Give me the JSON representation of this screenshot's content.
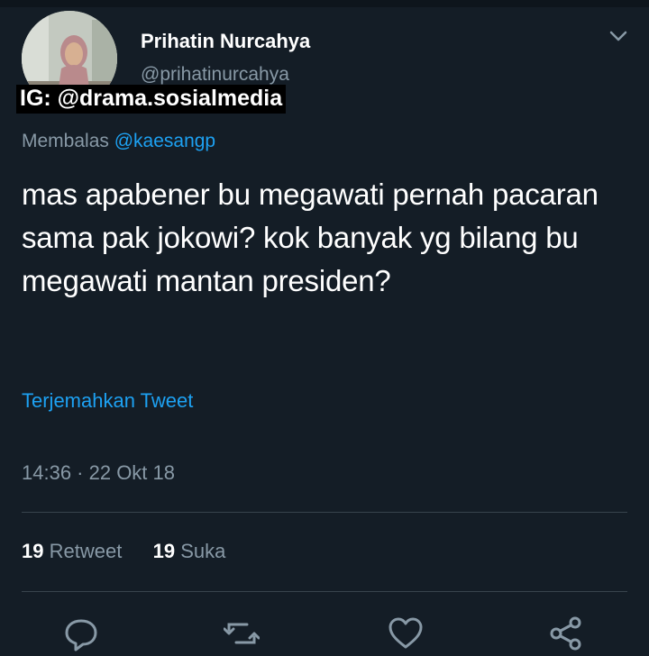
{
  "tweet": {
    "author_name": "Prihatin Nurcahya",
    "author_handle": "@prihatinurcahya",
    "watermark": "IG: @drama.sosialmedia",
    "reply_prefix": "Membalas",
    "reply_mention": "@kaesangp",
    "text": "mas apabener bu megawati pernah pacaran sama pak jokowi? kok banyak yg bilang bu megawati mantan presiden?",
    "translate_label": "Terjemahkan Tweet",
    "timestamp": "14:36 · 22 Okt 18",
    "retweet_count": "19",
    "retweet_label": "Retweet",
    "like_count": "19",
    "like_label": "Suka"
  },
  "icons": {
    "menu": "chevron-down-icon",
    "reply": "reply-icon",
    "retweet": "retweet-icon",
    "like": "heart-icon",
    "share": "share-icon"
  },
  "colors": {
    "background": "#141d26",
    "text": "#ffffff",
    "secondary": "#8899a6",
    "link": "#1da1f2",
    "divider": "#38444d"
  }
}
